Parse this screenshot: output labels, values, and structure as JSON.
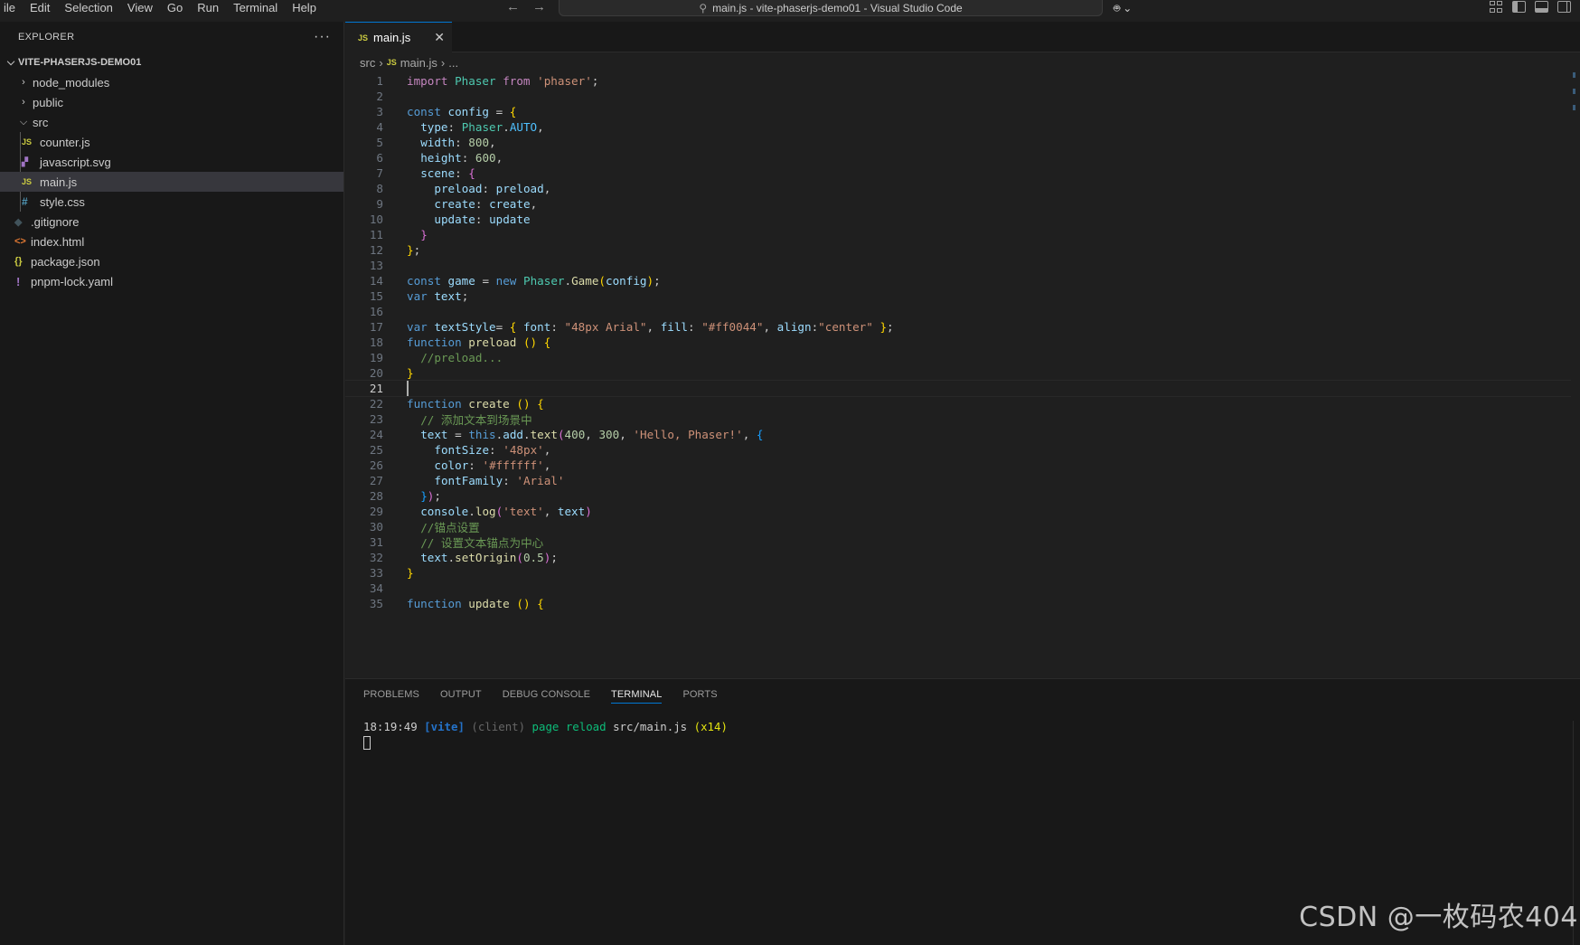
{
  "menu": [
    "ile",
    "Edit",
    "Selection",
    "View",
    "Go",
    "Run",
    "Terminal",
    "Help"
  ],
  "window_title": "main.js - vite-phaserjs-demo01 - Visual Studio Code",
  "explorer": {
    "title": "EXPLORER",
    "more": "···",
    "root": "VITE-PHASERJS-DEMO01",
    "items": [
      {
        "label": "node_modules",
        "kind": "folder",
        "icon": "chevron-right-icon"
      },
      {
        "label": "public",
        "kind": "folder",
        "icon": "chevron-right-icon"
      },
      {
        "label": "src",
        "kind": "folder-open",
        "icon": "chevron-down-icon"
      },
      {
        "label": "counter.js",
        "kind": "js",
        "icon": "JS"
      },
      {
        "label": "javascript.svg",
        "kind": "svg",
        "icon": "svg-icon"
      },
      {
        "label": "main.js",
        "kind": "js",
        "icon": "JS",
        "selected": true
      },
      {
        "label": "style.css",
        "kind": "css",
        "icon": "#"
      },
      {
        "label": ".gitignore",
        "kind": "git",
        "icon": "◆"
      },
      {
        "label": "index.html",
        "kind": "html",
        "icon": "<>"
      },
      {
        "label": "package.json",
        "kind": "json",
        "icon": "{}"
      },
      {
        "label": "pnpm-lock.yaml",
        "kind": "yaml",
        "icon": "!"
      }
    ]
  },
  "editor": {
    "tab": {
      "icon": "JS",
      "label": "main.js",
      "close": "✕"
    },
    "breadcrumb": [
      "src",
      "main.js",
      "..."
    ],
    "current_line": 21,
    "line_numbers": [
      "1",
      "2",
      "3",
      "4",
      "5",
      "6",
      "7",
      "8",
      "9",
      "10",
      "11",
      "12",
      "13",
      "14",
      "15",
      "16",
      "17",
      "18",
      "19",
      "20",
      "21",
      "22",
      "23",
      "24",
      "25",
      "26",
      "27",
      "28",
      "29",
      "30",
      "31",
      "32",
      "33",
      "34",
      "35"
    ],
    "code": [
      "import Phaser from 'phaser';",
      "",
      "const config = {",
      "  type: Phaser.AUTO,",
      "  width: 800,",
      "  height: 600,",
      "  scene: {",
      "    preload: preload,",
      "    create: create,",
      "    update: update",
      "  }",
      "};",
      "",
      "const game = new Phaser.Game(config);",
      "var text;",
      "",
      "var textStyle= { font: \"48px Arial\", fill: \"#ff0044\", align:\"center\" };",
      "function preload () {",
      "  //preload...",
      "}",
      "",
      "function create () {",
      "  // 添加文本到场景中",
      "  text = this.add.text(400, 300, 'Hello, Phaser!', {",
      "    fontSize: '48px',",
      "    color: '#ffffff',",
      "    fontFamily: 'Arial'",
      "  });",
      "  console.log('text', text)",
      "  //锚点设置",
      "  // 设置文本锚点为中心",
      "  text.setOrigin(0.5);",
      "}",
      "",
      "function update () {"
    ]
  },
  "panel": {
    "tabs": [
      "PROBLEMS",
      "OUTPUT",
      "DEBUG CONSOLE",
      "TERMINAL",
      "PORTS"
    ],
    "active_tab": "TERMINAL",
    "terminal": {
      "time": "18:19:49",
      "tag": "[vite]",
      "client": "(client)",
      "message": "page reload",
      "file": "src/main.js",
      "count": "(x14)"
    }
  },
  "watermark": "CSDN @一枚码农404",
  "colors": {
    "accent": "#0078d4",
    "js_icon": "#cbcb41",
    "keyword": "#569cd6",
    "string": "#ce9178",
    "comment": "#6a9955"
  }
}
